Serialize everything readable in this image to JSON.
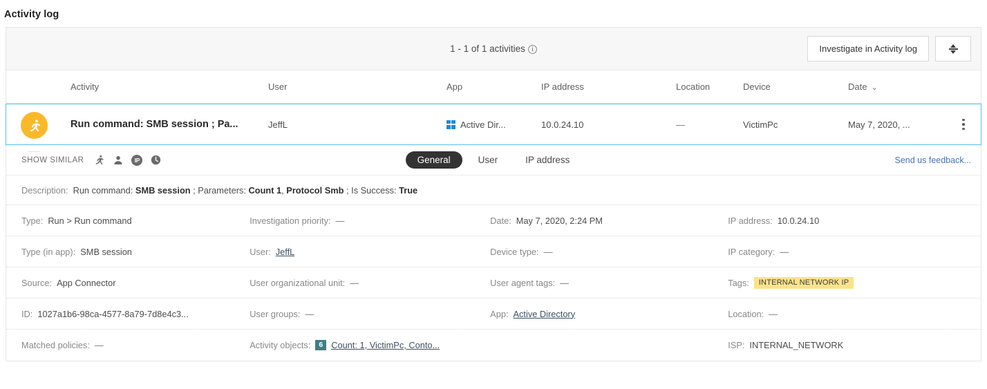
{
  "page_title": "Activity log",
  "toolbar": {
    "count_text": "1 - 1 of 1 activities",
    "info_glyph": "i",
    "investigate_button": "Investigate in Activity log",
    "expand_button_name": "expand-collapse-rows"
  },
  "table": {
    "columns": [
      {
        "key": "activity",
        "label": "Activity"
      },
      {
        "key": "user",
        "label": "User"
      },
      {
        "key": "app",
        "label": "App"
      },
      {
        "key": "ip",
        "label": "IP address"
      },
      {
        "key": "location",
        "label": "Location"
      },
      {
        "key": "device",
        "label": "Device"
      },
      {
        "key": "date",
        "label": "Date"
      }
    ],
    "sort_column": "Date",
    "sort_caret": "⌄",
    "row": {
      "icon": "running-person-icon",
      "icon_color": "#fbb829",
      "activity": "Run command: SMB session ; Pa...",
      "user": "JeffL",
      "app": "Active Dir...",
      "app_icon": "windows-logo-icon",
      "ip": "10.0.24.10",
      "location": "—",
      "device": "VictimPc",
      "date": "May 7, 2020, ..."
    }
  },
  "sub_bar": {
    "show_similar_label": "SHOW SIMILAR",
    "show_similar_icons": [
      "running-person-icon",
      "user-icon",
      "ip-icon",
      "clock-icon"
    ],
    "ip_chip_text": "IP",
    "tabs": [
      {
        "label": "General",
        "active": true
      },
      {
        "label": "User",
        "active": false
      },
      {
        "label": "IP address",
        "active": false
      }
    ],
    "feedback_link": "Send us feedback..."
  },
  "description": {
    "label": "Description:",
    "part1": "Run command:",
    "bold1": "SMB session",
    "sep1": "; Parameters:",
    "bold2": "Count 1",
    "comma": ",",
    "bold3": "Protocol Smb",
    "sep2": "; Is Success:",
    "bold4": "True"
  },
  "details": {
    "rows": [
      [
        {
          "label": "Type:",
          "value": "Run > Run command"
        },
        {
          "label": "Investigation priority:",
          "value": "—"
        },
        {
          "label": "Date:",
          "value": "May 7, 2020, 2:24 PM"
        },
        {
          "label": "IP address:",
          "value": "10.0.24.10"
        }
      ],
      [
        {
          "label": "Type (in app):",
          "value": "SMB session"
        },
        {
          "label": "User:",
          "value": "JeffL",
          "link": true
        },
        {
          "label": "Device type:",
          "value": "—"
        },
        {
          "label": "IP category:",
          "value": "—"
        }
      ],
      [
        {
          "label": "Source:",
          "value": "App Connector"
        },
        {
          "label": "User organizational unit:",
          "value": "—"
        },
        {
          "label": "User agent tags:",
          "value": "—"
        },
        {
          "label": "Tags:",
          "value": "INTERNAL NETWORK IP",
          "badge": "tag"
        }
      ],
      [
        {
          "label": "ID:",
          "value": "1027a1b6-98ca-4577-8a79-7d8e4c3..."
        },
        {
          "label": "User groups:",
          "value": "—"
        },
        {
          "label": "App:",
          "value": "Active Directory",
          "link": true
        },
        {
          "label": "Location:",
          "value": "—"
        }
      ],
      [
        {
          "label": "Matched policies:",
          "value": "—"
        },
        {
          "label": "Activity objects:",
          "value": "Count: 1, VictimPc, Conto...",
          "link": true,
          "count": "6"
        },
        {
          "label": "",
          "value": ""
        },
        {
          "label": "ISP:",
          "value": "INTERNAL_NETWORK"
        }
      ]
    ]
  },
  "colors": {
    "selected_row_border": "#51c2e8",
    "activity_icon": "#fbb829",
    "tag_badge": "#fbe38b",
    "count_badge": "#3f7e87",
    "link": "#3d4f61",
    "feedback_link": "#4a72b5",
    "active_tab_bg": "#333333"
  }
}
